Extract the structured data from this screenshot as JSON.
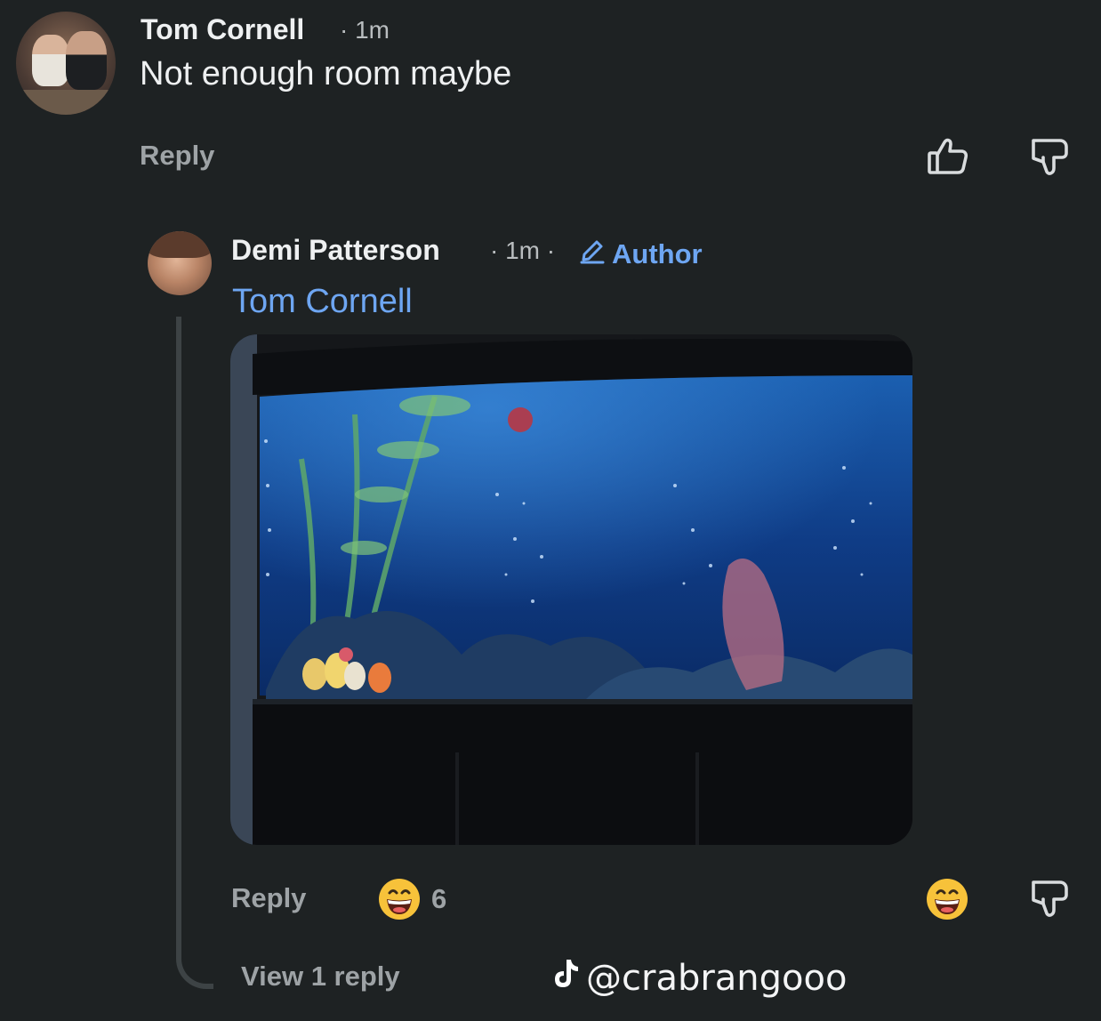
{
  "comment": {
    "author": "Tom Cornell",
    "time": "· 1m",
    "text": "Not enough room maybe",
    "reply_label": "Reply"
  },
  "reply": {
    "author": "Demi Patterson",
    "time": "· 1m ·",
    "badge": "Author",
    "mention": "Tom Cornell",
    "reply_label": "Reply",
    "reaction_count": "6",
    "view_replies_label": "View 1 reply"
  },
  "icons": {
    "like": "thumbs-up-icon",
    "dislike": "thumbs-down-icon",
    "reaction": "grinning-face-emoji",
    "edit": "pencil-icon",
    "brand": "tiktok-icon"
  },
  "watermark": "@crabrangooo",
  "colors": {
    "background": "#1e2223",
    "link": "#6ea6f2",
    "muted": "#9ea3a6",
    "text": "#eef0f1"
  }
}
